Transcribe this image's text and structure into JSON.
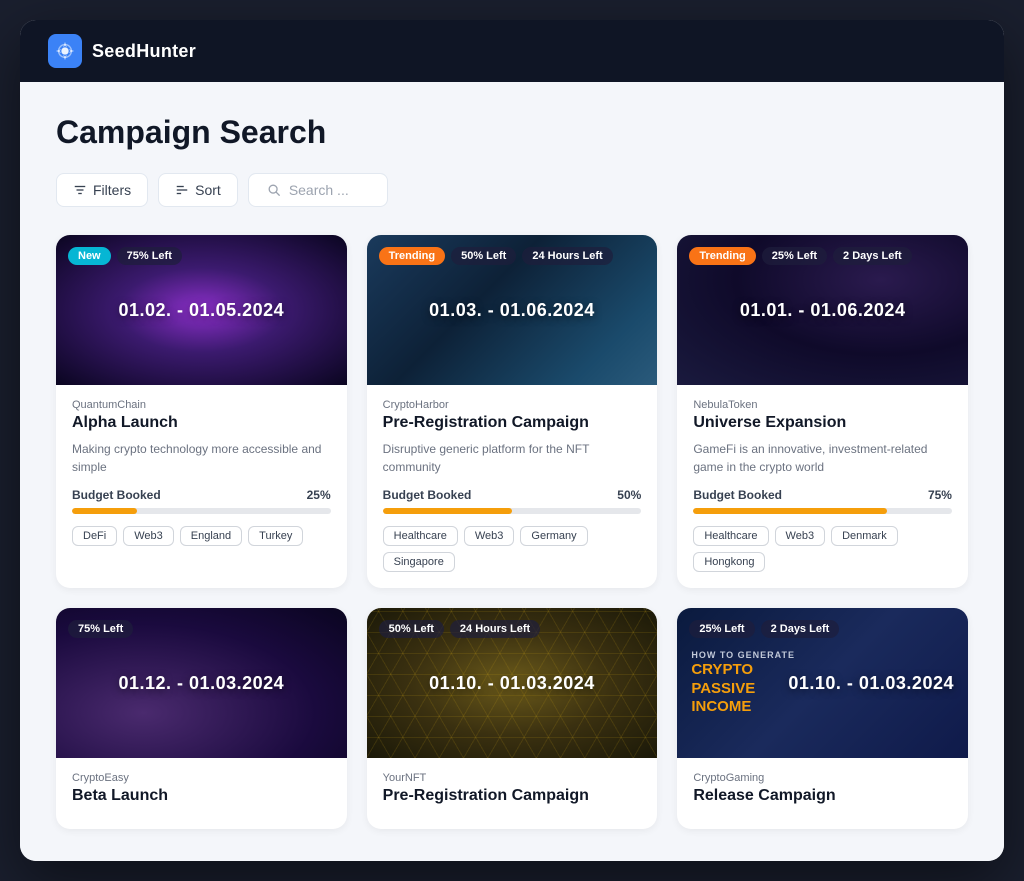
{
  "app": {
    "name": "SeedHunter",
    "logo_symbol": "⚙"
  },
  "page": {
    "title": "Campaign Search"
  },
  "toolbar": {
    "filters_label": "Filters",
    "sort_label": "Sort",
    "search_placeholder": "Search ..."
  },
  "campaigns": [
    {
      "id": 1,
      "status_badge": "New",
      "status_type": "new",
      "percent_left": "75% Left",
      "time_left": null,
      "date_range": "01.02. - 01.05.2024",
      "company": "QuantumChain",
      "title": "Alpha Launch",
      "description": "Making crypto technology more accessible and simple",
      "budget_label": "Budget Booked",
      "budget_pct": "25%",
      "budget_fill": 25,
      "tags": [
        "DeFi",
        "Web3",
        "England",
        "Turkey"
      ],
      "bg_class": "bg-quantum"
    },
    {
      "id": 2,
      "status_badge": "Trending",
      "status_type": "trending",
      "percent_left": "50% Left",
      "time_left": "24 Hours Left",
      "date_range": "01.03. - 01.06.2024",
      "company": "CryptoHarbor",
      "title": "Pre-Registration Campaign",
      "description": "Disruptive generic platform for the NFT community",
      "budget_label": "Budget Booked",
      "budget_pct": "50%",
      "budget_fill": 50,
      "tags": [
        "Healthcare",
        "Web3",
        "Germany",
        "Singapore"
      ],
      "bg_class": "bg-crypto-harbor"
    },
    {
      "id": 3,
      "status_badge": "Trending",
      "status_type": "trending",
      "percent_left": "25% Left",
      "time_left": "2 Days Left",
      "date_range": "01.01. - 01.06.2024",
      "company": "NebulaToken",
      "title": "Universe Expansion",
      "description": "GameFi is an innovative, investment-related game in the crypto world",
      "budget_label": "Budget Booked",
      "budget_pct": "75%",
      "budget_fill": 75,
      "tags": [
        "Healthcare",
        "Web3",
        "Denmark",
        "Hongkong"
      ],
      "bg_class": "bg-nebula"
    },
    {
      "id": 4,
      "status_badge": null,
      "status_type": null,
      "percent_left": "75% Left",
      "time_left": null,
      "date_range": "01.12. - 01.03.2024",
      "company": "CryptoEasy",
      "title": "Beta Launch",
      "description": "",
      "budget_label": "",
      "budget_pct": "",
      "budget_fill": 0,
      "tags": [],
      "bg_class": "bg-crypto-easy"
    },
    {
      "id": 5,
      "status_badge": null,
      "status_type": null,
      "percent_left": "50% Left",
      "time_left": "24 Hours Left",
      "date_range": "01.10. - 01.03.2024",
      "company": "YourNFT",
      "title": "Pre-Registration Campaign",
      "description": "",
      "budget_label": "",
      "budget_pct": "",
      "budget_fill": 0,
      "tags": [],
      "bg_class": "bg-your-nft",
      "hex_overlay": true
    },
    {
      "id": 6,
      "status_badge": null,
      "status_type": null,
      "percent_left": "25% Left",
      "time_left": "2 Days Left",
      "date_range": "01.10. - 01.03.2024",
      "company": "CryptoGaming",
      "title": "Release Campaign",
      "description": "",
      "budget_label": "",
      "budget_pct": "",
      "budget_fill": 0,
      "tags": [],
      "bg_class": "bg-crypto-gaming"
    }
  ]
}
